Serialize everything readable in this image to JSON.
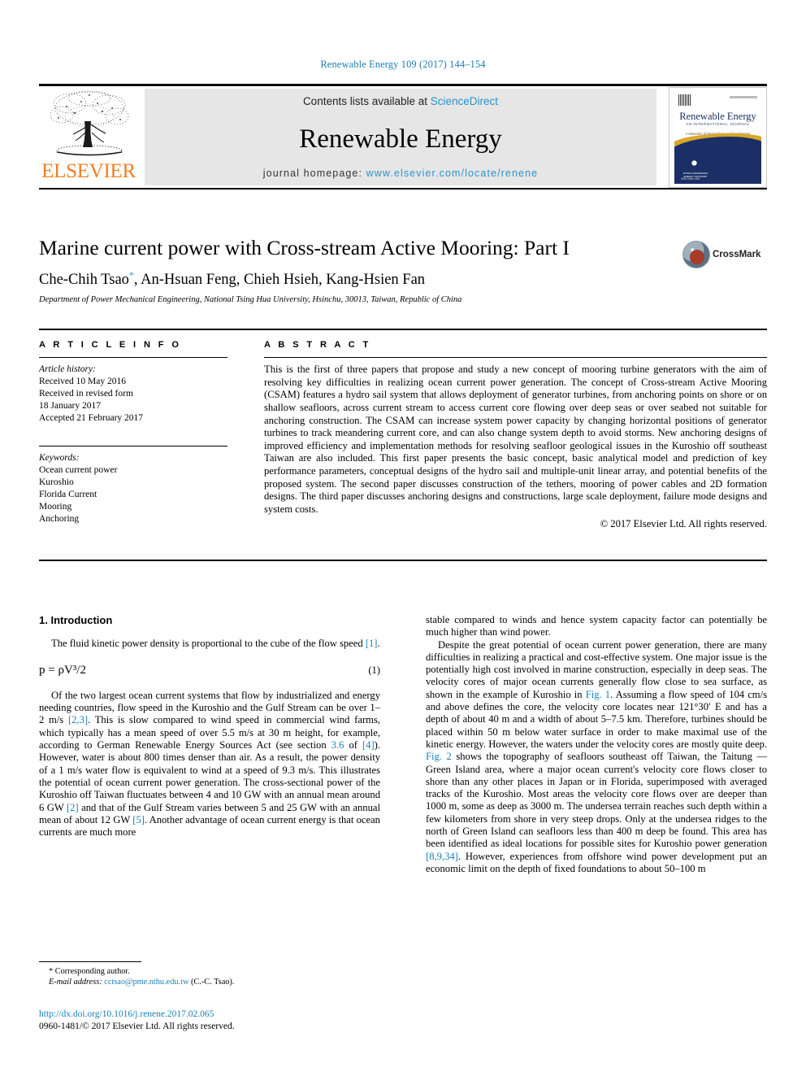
{
  "running_head": "Renewable Energy 109 (2017) 144–154",
  "banner": {
    "contents_prefix": "Contents lists available at ",
    "sciencedirect": "ScienceDirect",
    "journal_title": "Renewable Energy",
    "homepage_prefix": "journal homepage: ",
    "homepage_url": "www.elsevier.com/locate/renene",
    "publisher": "ELSEVIER",
    "logo_icon": "elsevier-tree-icon"
  },
  "cover": {
    "name": "Renewable Energy",
    "subtitle": "AN INTERNATIONAL JOURNAL",
    "subtitle2": "A Selection of Best Volume Subject Papers",
    "emblem_text": "WORLD RENEWABLE ENERGY NETWORK",
    "footer": "ISSN 0960-1481"
  },
  "article": {
    "title": "Marine current power with Cross-stream Active Mooring: Part I",
    "authors": "Che-Chih Tsao, An-Hsuan Feng, Chieh Hsieh, Kang-Hsien Fan",
    "corresponding_marker": "*",
    "affiliation": "Department of Power Mechanical Engineering, National Tsing Hua University, Hsinchu, 30013, Taiwan, Republic of China",
    "crossmark_label": "CrossMark"
  },
  "info": {
    "heading": "A R T I C L E  I N F O",
    "history_label": "Article history:",
    "history": [
      "Received 10 May 2016",
      "Received in revised form",
      "18 January 2017",
      "Accepted 21 February 2017"
    ],
    "keywords_label": "Keywords:",
    "keywords": [
      "Ocean current power",
      "Kuroshio",
      "Florida Current",
      "Mooring",
      "Anchoring"
    ]
  },
  "abstract": {
    "heading": "A B S T R A C T",
    "body": "This is the first of three papers that propose and study a new concept of mooring turbine generators with the aim of resolving key difficulties in realizing ocean current power generation. The concept of Cross-stream Active Mooring (CSAM) features a hydro sail system that allows deployment of generator turbines, from anchoring points on shore or on shallow seafloors, across current stream to access current core flowing over deep seas or over seabed not suitable for anchoring construction. The CSAM can increase system power capacity by changing horizontal positions of generator turbines to track meandering current core, and can also change system depth to avoid storms. New anchoring designs of improved efficiency and implementation methods for resolving seafloor geological issues in the Kuroshio off southeast Taiwan are also included. This first paper presents the basic concept, basic analytical model and prediction of key performance parameters, conceptual designs of the hydro sail and multiple-unit linear array, and potential benefits of the proposed system. The second paper discusses construction of the tethers, mooring of power cables and 2D formation designs. The third paper discusses anchoring designs and constructions, large scale deployment, failure mode designs and system costs.",
    "copyright": "© 2017 Elsevier Ltd. All rights reserved."
  },
  "body": {
    "section_title": "1. Introduction",
    "left_p1_a": "The fluid kinetic power density is proportional to the cube of the flow speed ",
    "left_p1_ref": "[1]",
    "left_p1_b": ".",
    "equation": "p = ρV³/2",
    "equation_number": "(1)",
    "left_p2_a": "Of the two largest ocean current systems that flow by industrialized and energy needing countries, flow speed in the Kuroshio and the Gulf Stream can be over 1–2 m/s ",
    "left_p2_ref1": "[2,3]",
    "left_p2_b": ". This is slow compared to wind speed in commercial wind farms, which typically has a mean speed of over 5.5 m/s at 30 m height, for example, according to German Renewable Energy Sources Act (see section ",
    "left_p2_ref2": "3.6",
    "left_p2_c": " of ",
    "left_p2_ref3": "[4]",
    "left_p2_d": "). However, water is about 800 times denser than air. As a result, the power density of a 1 m/s water flow is equivalent to wind at a speed of 9.3 m/s. This illustrates the potential of ocean current power generation. The cross-sectional power of the Kuroshio off Taiwan fluctuates between 4 and 10 GW with an annual mean around 6 GW ",
    "left_p2_ref4": "[2]",
    "left_p2_e": " and that of the Gulf Stream varies between 5 and 25 GW with an annual mean of about 12 GW ",
    "left_p2_ref5": "[5]",
    "left_p2_f": ". Another advantage of ocean current energy is that ocean currents are much more",
    "right_p1": "stable compared to winds and hence system capacity factor can potentially be much higher than wind power.",
    "right_p2_a": "Despite the great potential of ocean current power generation, there are many difficulties in realizing a practical and cost-effective system. One major issue is the potentially high cost involved in marine construction, especially in deep seas. The velocity cores of major ocean currents generally flow close to sea surface, as shown in the example of Kuroshio in ",
    "right_p2_fig1": "Fig. 1",
    "right_p2_b": ". Assuming a flow speed of 104 cm/s and above defines the core, the velocity core locates near 121°30′ E and has a depth of about 40 m and a width of about 5–7.5 km. Therefore, turbines should be placed within 50 m below water surface in order to make maximal use of the kinetic energy. However, the waters under the velocity cores are mostly quite deep. ",
    "right_p2_fig2": "Fig. 2",
    "right_p2_c": " shows the topography of seafloors southeast off Taiwan, the Taitung — Green Island area, where a major ocean current's velocity core flows closer to shore than any other places in Japan or in Florida, superimposed with averaged tracks of the Kuroshio. Most areas the velocity core flows over are deeper than 1000 m, some as deep as 3000 m. The undersea terrain reaches such depth within a few kilometers from shore in very steep drops. Only at the undersea ridges to the north of Green Island can seafloors less than 400 m deep be found. This area has been identified as ideal locations for possible sites for Kuroshio power generation ",
    "right_p2_ref": "[8,9,34]",
    "right_p2_d": ". However, experiences from offshore wind power development put an economic limit on the depth of fixed foundations to about 50–100 m"
  },
  "footnote": {
    "corresponding": "* Corresponding author.",
    "email_label": "E-mail address:",
    "email": "cctsao@pme.nthu.edu.tw",
    "email_suffix": " (C.-C. Tsao).",
    "doi": "http://dx.doi.org/10.1016/j.renene.2017.02.065",
    "issn_copyright": "0960-1481/© 2017 Elsevier Ltd. All rights reserved."
  },
  "colors": {
    "link": "#1a7fb5",
    "sciencedirect": "#2b93cc",
    "elsevier_orange": "#f47c20",
    "banner_bg": "#e6e6e6"
  }
}
